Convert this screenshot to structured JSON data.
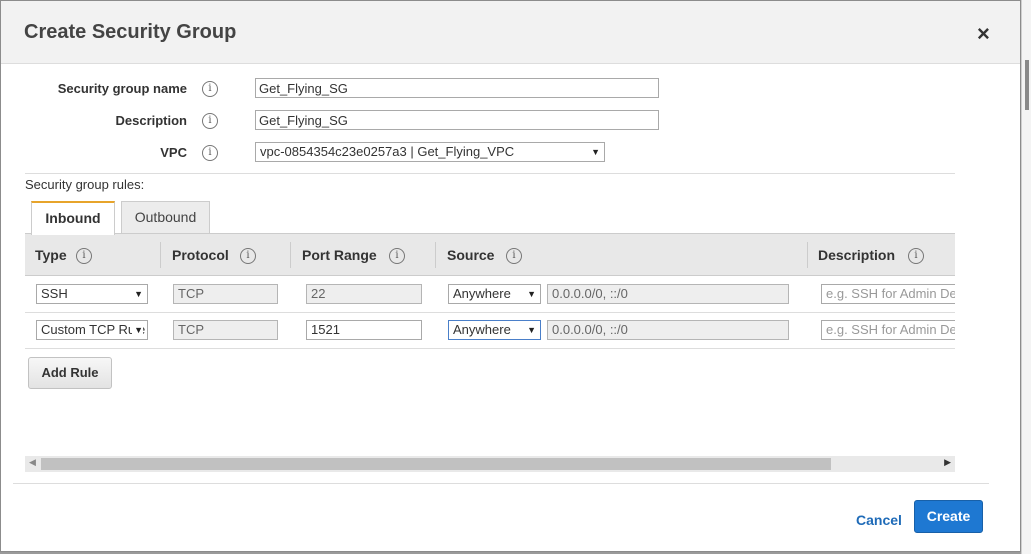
{
  "dialog": {
    "title": "Create Security Group",
    "close_glyph": "×"
  },
  "form": {
    "name_label": "Security group name",
    "name_value": "Get_Flying_SG",
    "description_label": "Description",
    "description_value": "Get_Flying_SG",
    "vpc_label": "VPC",
    "vpc_value": "vpc-0854354c23e0257a3 | Get_Flying_VPC"
  },
  "rules": {
    "caption": "Security group rules:",
    "tabs": [
      "Inbound",
      "Outbound"
    ],
    "active_tab": "Inbound",
    "columns": [
      "Type",
      "Protocol",
      "Port Range",
      "Source",
      "Description"
    ],
    "rows": [
      {
        "type": "SSH",
        "protocol": "TCP",
        "port_range": "22",
        "source": "Anywhere",
        "cidr": "0.0.0.0/0, ::/0",
        "description_placeholder": "e.g. SSH for Admin Desktop"
      },
      {
        "type": "Custom TCP Rule",
        "protocol": "TCP",
        "port_range": "1521",
        "source": "Anywhere",
        "cidr": "0.0.0.0/0, ::/0",
        "description_placeholder": "e.g. SSH for Admin Desktop"
      }
    ],
    "add_rule_label": "Add Rule"
  },
  "footer": {
    "cancel_label": "Cancel",
    "create_label": "Create"
  },
  "icons": {
    "info": "i",
    "dropdown": "▼",
    "scroll_left": "◀",
    "scroll_right": "▶"
  },
  "colors": {
    "primary_button": "#1e78d2",
    "active_tab_accent": "#e7a42b",
    "link": "#1f6bb8"
  }
}
